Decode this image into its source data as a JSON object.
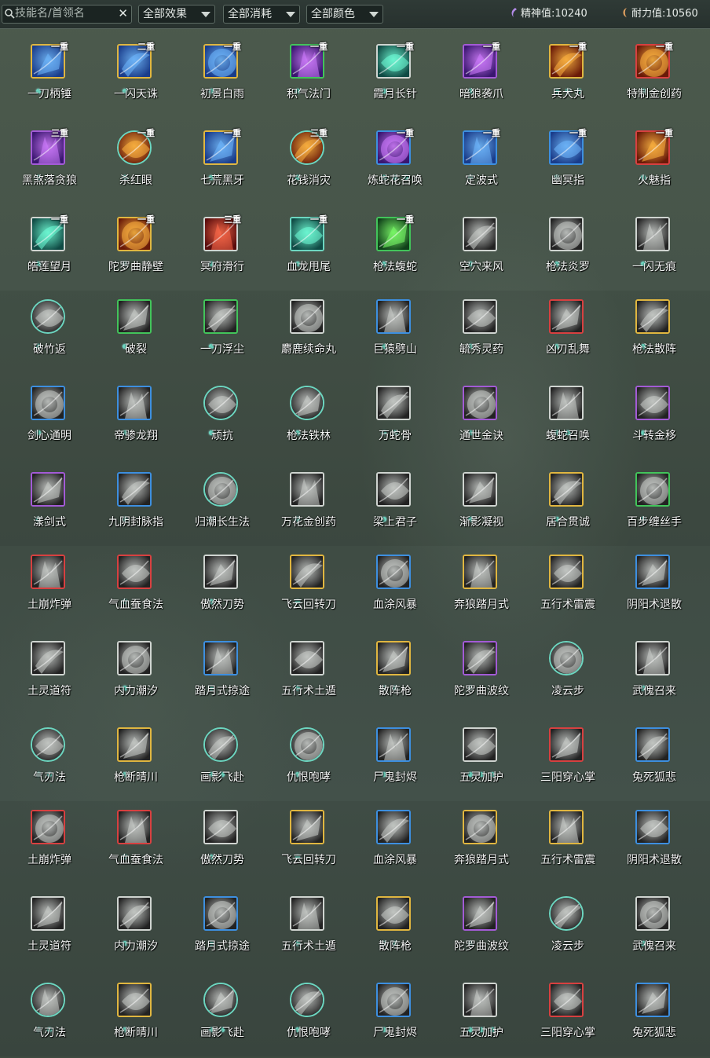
{
  "search": {
    "placeholder": "技能名/首领名",
    "clear_icon": "close-icon"
  },
  "filters": [
    {
      "label": "全部效果",
      "name": "effect-filter"
    },
    {
      "label": "全部消耗",
      "name": "cost-filter"
    },
    {
      "label": "全部颜色",
      "name": "color-filter"
    }
  ],
  "stats": {
    "spirit": {
      "label": "精神值:",
      "value": "10240"
    },
    "stamina": {
      "label": "耐力值:",
      "value": "10560"
    }
  },
  "colors": {
    "gold": "#e0b640",
    "blue": "#3d8fe0",
    "purple": "#a35bd6",
    "green": "#42c45a",
    "red": "#d84040",
    "gray": "#cfd4d0",
    "teal": "#6cd6c0"
  },
  "rows": [
    [
      {
        "name": "一刀柄锤",
        "badge": "一重",
        "frame": "gold",
        "dots": 1,
        "tone": "blue"
      },
      {
        "name": "一闪天诛",
        "badge": "二重",
        "frame": "gold",
        "dots": 1,
        "tone": "blue"
      },
      {
        "name": "初景白雨",
        "badge": "一重",
        "frame": "gold",
        "dots": 1,
        "tone": "blue"
      },
      {
        "name": "积气法门",
        "badge": "一重",
        "frame": "green",
        "dots": 1,
        "tone": "purple"
      },
      {
        "name": "霞月长针",
        "badge": "一重",
        "frame": "gray",
        "dots": 1,
        "tone": "teal"
      },
      {
        "name": "暗狼袭爪",
        "badge": "一重",
        "frame": "purple",
        "dots": 1,
        "tone": "purple"
      },
      {
        "name": "兵犬丸",
        "badge": "一重",
        "frame": "gold",
        "dots": 3,
        "tone": "fire"
      },
      {
        "name": "特制金创药",
        "badge": "一重",
        "frame": "red",
        "dots": 1,
        "tone": "fire"
      }
    ],
    [
      {
        "name": "黑煞落贪狼",
        "badge": "三重",
        "frame": "purple",
        "dots": 1,
        "tone": "purple"
      },
      {
        "name": "杀红眼",
        "badge": "一重",
        "frame": "round-teal",
        "dots": 1,
        "tone": "fire"
      },
      {
        "name": "七荒黑牙",
        "badge": "一重",
        "frame": "gold",
        "dots": 1,
        "tone": "blue"
      },
      {
        "name": "花钱消灾",
        "badge": "三重",
        "frame": "round-teal",
        "dots": 1,
        "tone": "fire"
      },
      {
        "name": "炼蛇花召唤",
        "badge": "一重",
        "frame": "blue",
        "dots": 3,
        "tone": "purple"
      },
      {
        "name": "定波式",
        "badge": "一重",
        "frame": "blue",
        "dots": 1,
        "tone": "blue"
      },
      {
        "name": "幽冥指",
        "badge": "一重",
        "frame": "blue",
        "dots": 1,
        "tone": "blue"
      },
      {
        "name": "火魅指",
        "badge": "一重",
        "frame": "red",
        "dots": 1,
        "tone": "fire"
      }
    ],
    [
      {
        "name": "皓莲望月",
        "badge": "一重",
        "frame": "gray",
        "dots": 1,
        "tone": "teal"
      },
      {
        "name": "陀罗曲静壁",
        "badge": "一重",
        "frame": "gold",
        "dots": 1,
        "tone": "fire"
      },
      {
        "name": "冥府滑行",
        "badge": "三重",
        "frame": "gray",
        "dots": 1,
        "tone": "red"
      },
      {
        "name": "血龙甩尾",
        "badge": "一重",
        "frame": "teal",
        "dots": 1,
        "tone": "teal"
      },
      {
        "name": "枪法蝮蛇",
        "badge": "一重",
        "frame": "green",
        "dots": 1,
        "tone": "green"
      },
      {
        "name": "空穴来风",
        "badge": "",
        "frame": "gray",
        "dots": 1,
        "tone": "gray"
      },
      {
        "name": "枪法炎罗",
        "badge": "",
        "frame": "gray",
        "dots": 1,
        "tone": "gray"
      },
      {
        "name": "一闪无痕",
        "badge": "",
        "frame": "gray",
        "dots": 1,
        "tone": "gray"
      }
    ],
    [
      {
        "name": "破竹返",
        "badge": "",
        "frame": "round-teal",
        "dots": 1,
        "tone": "gray"
      },
      {
        "name": "破裂",
        "badge": "",
        "frame": "green",
        "dots": 1,
        "tone": "gray"
      },
      {
        "name": "一刀浮尘",
        "badge": "",
        "frame": "green",
        "dots": 1,
        "tone": "gray"
      },
      {
        "name": "麝鹿续命丸",
        "badge": "",
        "frame": "gray",
        "dots": 1,
        "tone": "gray"
      },
      {
        "name": "巨猿劈山",
        "badge": "",
        "frame": "blue",
        "dots": 1,
        "tone": "gray"
      },
      {
        "name": "毓秀灵药",
        "badge": "",
        "frame": "gray",
        "dots": 1,
        "tone": "gray"
      },
      {
        "name": "凶刃乱舞",
        "badge": "",
        "frame": "red",
        "dots": 1,
        "tone": "gray"
      },
      {
        "name": "枪法散阵",
        "badge": "",
        "frame": "gold",
        "dots": 1,
        "tone": "gray"
      }
    ],
    [
      {
        "name": "剑心通明",
        "badge": "",
        "frame": "blue",
        "dots": 1,
        "tone": "gray"
      },
      {
        "name": "帝骖龙翔",
        "badge": "",
        "frame": "blue",
        "dots": 1,
        "tone": "gray"
      },
      {
        "name": "顽抗",
        "badge": "",
        "frame": "round-teal",
        "dots": 1,
        "tone": "gray"
      },
      {
        "name": "枪法铁林",
        "badge": "",
        "frame": "round-teal",
        "dots": 1,
        "tone": "gray"
      },
      {
        "name": "万蛇骨",
        "badge": "",
        "frame": "gray",
        "dots": 2,
        "tone": "gray"
      },
      {
        "name": "通世金诀",
        "badge": "",
        "frame": "purple",
        "dots": 1,
        "tone": "gray"
      },
      {
        "name": "蝮蛇召唤",
        "badge": "",
        "frame": "gray",
        "dots": 2,
        "tone": "gray"
      },
      {
        "name": "斗转金移",
        "badge": "",
        "frame": "purple",
        "dots": 1,
        "tone": "gray"
      }
    ],
    [
      {
        "name": "漾剑式",
        "badge": "",
        "frame": "purple",
        "dots": 1,
        "tone": "gray"
      },
      {
        "name": "九阴封脉指",
        "badge": "",
        "frame": "blue",
        "dots": 1,
        "tone": "gray"
      },
      {
        "name": "归潮长生法",
        "badge": "",
        "frame": "round-teal",
        "dots": 1,
        "tone": "gray"
      },
      {
        "name": "万花金创药",
        "badge": "",
        "frame": "gray",
        "dots": 1,
        "tone": "gray"
      },
      {
        "name": "梁上君子",
        "badge": "",
        "frame": "gray",
        "dots": 1,
        "tone": "gray"
      },
      {
        "name": "渐影凝视",
        "badge": "",
        "frame": "gray",
        "dots": 1,
        "tone": "gray"
      },
      {
        "name": "居合贯诚",
        "badge": "",
        "frame": "gold",
        "dots": 1,
        "tone": "gray"
      },
      {
        "name": "百步缠丝手",
        "badge": "",
        "frame": "green",
        "dots": 1,
        "tone": "gray"
      }
    ],
    [
      {
        "name": "土崩炸弹",
        "badge": "",
        "frame": "red",
        "dots": 0,
        "tone": "gray"
      },
      {
        "name": "气血蚕食法",
        "badge": "",
        "frame": "red",
        "dots": 1,
        "tone": "gray"
      },
      {
        "name": "傲然刀势",
        "badge": "",
        "frame": "gray",
        "dots": 1,
        "tone": "gray"
      },
      {
        "name": "飞云回转刀",
        "badge": "",
        "frame": "gold",
        "dots": 1,
        "tone": "gray"
      },
      {
        "name": "血涂风暴",
        "badge": "",
        "frame": "blue",
        "dots": 0,
        "tone": "gray"
      },
      {
        "name": "奔狼踏月式",
        "badge": "",
        "frame": "gold",
        "dots": 0,
        "tone": "gray"
      },
      {
        "name": "五行术雷震",
        "badge": "",
        "frame": "gold",
        "dots": 0,
        "tone": "gray"
      },
      {
        "name": "阴阳术退散",
        "badge": "",
        "frame": "blue",
        "dots": 0,
        "tone": "gray"
      }
    ],
    [
      {
        "name": "土灵道符",
        "badge": "",
        "frame": "gray",
        "dots": 0,
        "tone": "gray"
      },
      {
        "name": "内力潮汐",
        "badge": "",
        "frame": "gray",
        "dots": 1,
        "tone": "gray"
      },
      {
        "name": "踏月式掠途",
        "badge": "",
        "frame": "blue",
        "dots": 1,
        "tone": "gray"
      },
      {
        "name": "五行术土遁",
        "badge": "",
        "frame": "gray",
        "dots": 1,
        "tone": "gray"
      },
      {
        "name": "散阵枪",
        "badge": "",
        "frame": "gold",
        "dots": 2,
        "tone": "gray"
      },
      {
        "name": "陀罗曲波纹",
        "badge": "",
        "frame": "purple",
        "dots": 1,
        "tone": "gray"
      },
      {
        "name": "凌云步",
        "badge": "",
        "frame": "round-teal",
        "dots": 0,
        "tone": "gray"
      },
      {
        "name": "武傀召来",
        "badge": "",
        "frame": "gray",
        "dots": 1,
        "tone": "gray"
      }
    ],
    [
      {
        "name": "气刃法",
        "badge": "",
        "frame": "round-teal",
        "dots": 2,
        "tone": "gray"
      },
      {
        "name": "枪断晴川",
        "badge": "",
        "frame": "gold",
        "dots": 1,
        "tone": "gray"
      },
      {
        "name": "画影飞赴",
        "badge": "",
        "frame": "round-teal",
        "dots": 2,
        "tone": "gray"
      },
      {
        "name": "仇恨咆哮",
        "badge": "",
        "frame": "round-teal",
        "dots": 1,
        "tone": "gray"
      },
      {
        "name": "尸鬼封烬",
        "badge": "",
        "frame": "blue",
        "dots": 1,
        "tone": "gray"
      },
      {
        "name": "五灵加护",
        "badge": "",
        "frame": "gray",
        "dots": 3,
        "tone": "gray"
      },
      {
        "name": "三阳穿心掌",
        "badge": "",
        "frame": "red",
        "dots": 0,
        "tone": "gray"
      },
      {
        "name": "兔死狐悲",
        "badge": "",
        "frame": "blue",
        "dots": 0,
        "tone": "gray"
      }
    ],
    [
      {
        "name": "土崩炸弹",
        "badge": "",
        "frame": "red",
        "dots": 0,
        "tone": "gray"
      },
      {
        "name": "气血蚕食法",
        "badge": "",
        "frame": "red",
        "dots": 1,
        "tone": "gray"
      },
      {
        "name": "傲然刀势",
        "badge": "",
        "frame": "gray",
        "dots": 1,
        "tone": "gray"
      },
      {
        "name": "飞云回转刀",
        "badge": "",
        "frame": "gold",
        "dots": 1,
        "tone": "gray"
      },
      {
        "name": "血涂风暴",
        "badge": "",
        "frame": "blue",
        "dots": 0,
        "tone": "gray"
      },
      {
        "name": "奔狼踏月式",
        "badge": "",
        "frame": "gold",
        "dots": 0,
        "tone": "gray"
      },
      {
        "name": "五行术雷震",
        "badge": "",
        "frame": "gold",
        "dots": 0,
        "tone": "gray"
      },
      {
        "name": "阴阳术退散",
        "badge": "",
        "frame": "blue",
        "dots": 0,
        "tone": "gray"
      }
    ],
    [
      {
        "name": "土灵道符",
        "badge": "",
        "frame": "gray",
        "dots": 0,
        "tone": "gray"
      },
      {
        "name": "内力潮汐",
        "badge": "",
        "frame": "gray",
        "dots": 1,
        "tone": "gray"
      },
      {
        "name": "踏月式掠途",
        "badge": "",
        "frame": "blue",
        "dots": 1,
        "tone": "gray"
      },
      {
        "name": "五行术土遁",
        "badge": "",
        "frame": "gray",
        "dots": 1,
        "tone": "gray"
      },
      {
        "name": "散阵枪",
        "badge": "",
        "frame": "gold",
        "dots": 2,
        "tone": "gray"
      },
      {
        "name": "陀罗曲波纹",
        "badge": "",
        "frame": "purple",
        "dots": 1,
        "tone": "gray"
      },
      {
        "name": "凌云步",
        "badge": "",
        "frame": "round-teal",
        "dots": 0,
        "tone": "gray"
      },
      {
        "name": "武傀召来",
        "badge": "",
        "frame": "gray",
        "dots": 1,
        "tone": "gray"
      }
    ],
    [
      {
        "name": "气刃法",
        "badge": "",
        "frame": "round-teal",
        "dots": 2,
        "tone": "gray"
      },
      {
        "name": "枪断晴川",
        "badge": "",
        "frame": "gold",
        "dots": 1,
        "tone": "gray"
      },
      {
        "name": "画影飞赴",
        "badge": "",
        "frame": "round-teal",
        "dots": 2,
        "tone": "gray"
      },
      {
        "name": "仇恨咆哮",
        "badge": "",
        "frame": "round-teal",
        "dots": 1,
        "tone": "gray"
      },
      {
        "name": "尸鬼封烬",
        "badge": "",
        "frame": "blue",
        "dots": 1,
        "tone": "gray"
      },
      {
        "name": "五灵加护",
        "badge": "",
        "frame": "gray",
        "dots": 3,
        "tone": "gray"
      },
      {
        "name": "三阳穿心掌",
        "badge": "",
        "frame": "red",
        "dots": 0,
        "tone": "gray"
      },
      {
        "name": "兔死狐悲",
        "badge": "",
        "frame": "blue",
        "dots": 0,
        "tone": "gray"
      }
    ]
  ]
}
